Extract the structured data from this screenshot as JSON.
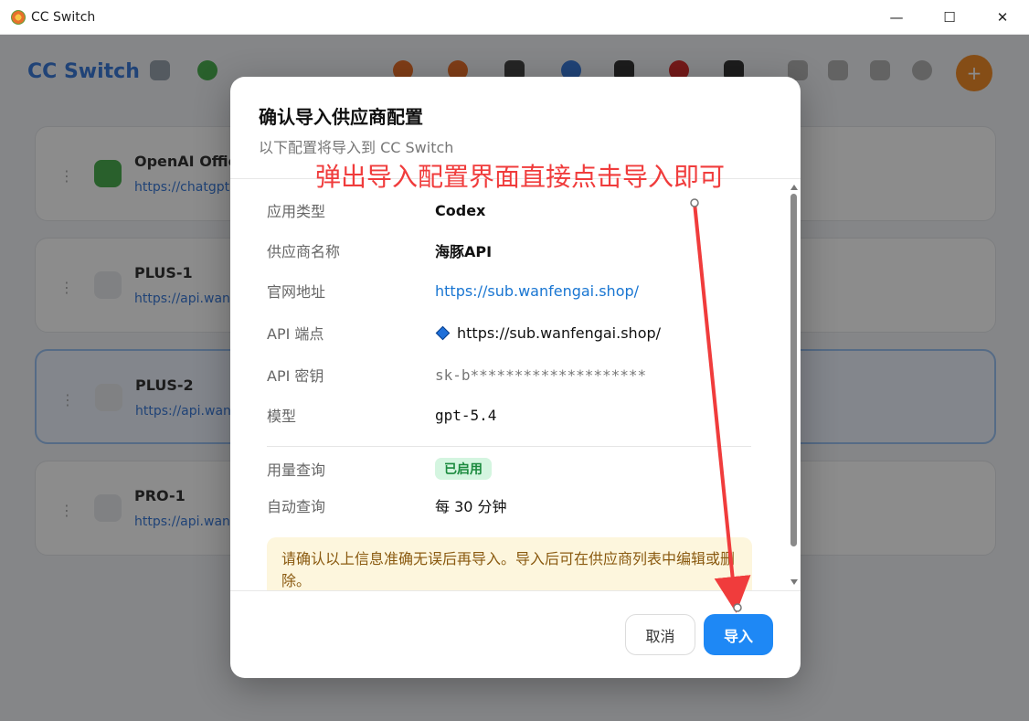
{
  "window": {
    "title": "CC Switch",
    "minimize_glyph": "—",
    "maximize_glyph": "☐",
    "close_glyph": "✕"
  },
  "background": {
    "brand": "CC Switch",
    "providers": [
      {
        "name": "OpenAI Official",
        "url": "https://chatgpt.com"
      },
      {
        "name": "PLUS-1",
        "url": "https://api.wanfengai.shop"
      },
      {
        "name": "PLUS-2",
        "url": "https://api.wanfengai.shop"
      },
      {
        "name": "PRO-1",
        "url": "https://api.wanfengai.shop"
      }
    ],
    "avatar_glyph": "+",
    "grip_glyph": "⋮"
  },
  "dialog": {
    "title": "确认导入供应商配置",
    "subtitle": "以下配置将导入到 CC Switch",
    "fields": {
      "app_type": {
        "label": "应用类型",
        "value": "Codex"
      },
      "provider_name": {
        "label": "供应商名称",
        "value": "海豚API"
      },
      "website": {
        "label": "官网地址",
        "value": "https://sub.wanfengai.shop/"
      },
      "endpoint": {
        "label": "API 端点",
        "value": "https://sub.wanfengai.shop/"
      },
      "api_key": {
        "label": "API 密钥",
        "value": "sk-b********************"
      },
      "model": {
        "label": "模型",
        "value": "gpt-5.4"
      },
      "usage_query": {
        "label": "用量查询",
        "value": "已启用"
      },
      "auto_query": {
        "label": "自动查询",
        "value": "每 30 分钟"
      }
    },
    "notice": "请确认以上信息准确无误后再导入。导入后可在供应商列表中编辑或删除。",
    "cancel_label": "取消",
    "import_label": "导入"
  },
  "annotation": {
    "text": "弹出导入配置界面直接点击导入即可",
    "color": "#f03c3c"
  },
  "colors": {
    "accent": "#1e88f5",
    "link": "#1976d2",
    "badge_bg": "#d4f5e0",
    "badge_text": "#1b8a3e",
    "notice_bg": "#fdf6dd"
  }
}
